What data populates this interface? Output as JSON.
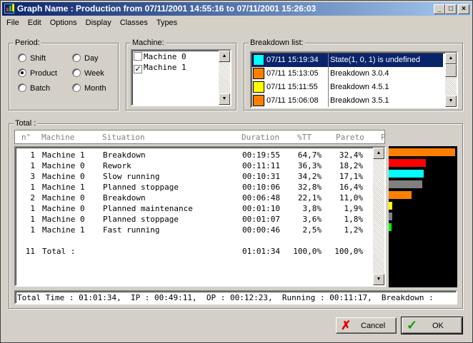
{
  "window": {
    "title": "Graph Name : Production from 07/11/2001 14:55:16 to 07/11/2001 15:26:03",
    "minimize": "_",
    "maximize": "□",
    "close": "×"
  },
  "menu": [
    "File",
    "Edit",
    "Options",
    "Display",
    "Classes",
    "Types"
  ],
  "period": {
    "label": "Period:",
    "options": [
      {
        "label": "Shift",
        "selected": false
      },
      {
        "label": "Product",
        "selected": true
      },
      {
        "label": "Batch",
        "selected": false
      },
      {
        "label": "Day",
        "selected": false
      },
      {
        "label": "Week",
        "selected": false
      },
      {
        "label": "Month",
        "selected": false
      }
    ]
  },
  "machine": {
    "label": "Machine:",
    "items": [
      {
        "label": "Machine 0",
        "checked": false,
        "mark": ""
      },
      {
        "label": "Machine 1",
        "checked": true,
        "mark": "✓"
      }
    ]
  },
  "breakdown": {
    "label": "Breakdown list:",
    "items": [
      {
        "time": "07/11 15:19:34",
        "desc": "State(1, 0, 1) is undefined",
        "color": "#00ffff",
        "selected": true
      },
      {
        "time": "07/11 15:13:05",
        "desc": "Breakdown 3.0.4",
        "color": "#ff8000",
        "selected": false
      },
      {
        "time": "07/11 15:11:55",
        "desc": "Breakdown 4.5.1",
        "color": "#ffff00",
        "selected": false
      },
      {
        "time": "07/11 15:06:08",
        "desc": "Breakdown 3.5.1",
        "color": "#ff8000",
        "selected": false
      }
    ]
  },
  "total": {
    "label": "Total :",
    "headers": {
      "n": "n°",
      "machine": "Machine",
      "situation": "Situation",
      "duration": "Duration",
      "tt": "%TT",
      "pareto": "Pareto",
      "extra": "P"
    },
    "rows": [
      {
        "n": "1",
        "machine": "Machine 1",
        "situation": "Breakdown",
        "duration": "00:19:55",
        "tt": "64,7%",
        "pareto": "32,4%",
        "color": "#ff8000",
        "share": 64.7
      },
      {
        "n": "1",
        "machine": "Machine 0",
        "situation": "Rework",
        "duration": "00:11:11",
        "tt": "36,3%",
        "pareto": "18,2%",
        "color": "#ff0000",
        "share": 36.3
      },
      {
        "n": "3",
        "machine": "Machine 0",
        "situation": "Slow running",
        "duration": "00:10:31",
        "tt": "34,2%",
        "pareto": "17,1%",
        "color": "#00ffff",
        "share": 34.2
      },
      {
        "n": "1",
        "machine": "Machine 1",
        "situation": "Planned stoppage",
        "duration": "00:10:06",
        "tt": "32,8%",
        "pareto": "16,4%",
        "color": "#808080",
        "share": 32.8
      },
      {
        "n": "2",
        "machine": "Machine 0",
        "situation": "Breakdown",
        "duration": "00:06:48",
        "tt": "22,1%",
        "pareto": "11,0%",
        "color": "#ff8000",
        "share": 22.1
      },
      {
        "n": "1",
        "machine": "Machine 0",
        "situation": "Planned maintenance",
        "duration": "00:01:10",
        "tt": "3,8%",
        "pareto": "1,9%",
        "color": "#ffff00",
        "share": 3.8
      },
      {
        "n": "1",
        "machine": "Machine 0",
        "situation": "Planned stoppage",
        "duration": "00:01:07",
        "tt": "3,6%",
        "pareto": "1,8%",
        "color": "#808080",
        "share": 3.6
      },
      {
        "n": "1",
        "machine": "Machine 1",
        "situation": "Fast running",
        "duration": "00:00:46",
        "tt": "2,5%",
        "pareto": "1,2%",
        "color": "#00ff00",
        "share": 2.5
      }
    ],
    "summary": {
      "n": "11",
      "label": "Total :",
      "duration": "01:01:34",
      "tt": "100,0%",
      "pareto": "100,0%"
    },
    "status": "Total Time : 01:01:34,  IP : 00:49:11,  OP : 00:12:23,  Running : 00:11:17,  Breakdown :"
  },
  "buttons": {
    "cancel": "Cancel",
    "ok": "OK"
  },
  "colors": {
    "titlebar_start": "#0a246a",
    "titlebar_end": "#a6caf0",
    "selection": "#0a246a",
    "window_bg": "#d4d0c8"
  }
}
